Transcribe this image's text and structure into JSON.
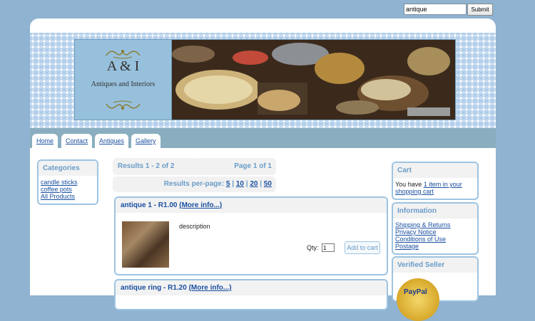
{
  "search": {
    "value": "antique",
    "submit_label": "Submit"
  },
  "logo": {
    "title": "A & I",
    "subtitle": "Antiques and Interiors"
  },
  "nav": {
    "tabs": [
      {
        "label": "Home"
      },
      {
        "label": "Contact"
      },
      {
        "label": "Antiques"
      },
      {
        "label": "Gallery"
      }
    ]
  },
  "categories": {
    "heading": "Categories",
    "items": [
      {
        "label": "candle sticks"
      },
      {
        "label": "coffee pots"
      },
      {
        "label": "All Products"
      }
    ]
  },
  "results": {
    "summary": "Results 1 - 2 of 2",
    "page": "Page 1 of 1",
    "per_page_label": "Results per-page:",
    "per_page_options": [
      "5",
      "10",
      "20",
      "50"
    ],
    "separator": "|"
  },
  "products": [
    {
      "title": "antique 1 - R1.00",
      "more_link": "(More info...)",
      "description": "description",
      "qty_label": "Qty:",
      "qty_value": "1",
      "add_label": "Add to cart"
    },
    {
      "title": "antique ring - R1.20",
      "more_link": "(More info...)"
    }
  ],
  "cart": {
    "heading": "Cart",
    "text_prefix": "You have",
    "link_line1": "1 item in your",
    "link_line2": "shopping cart"
  },
  "information": {
    "heading": "Information",
    "items": [
      {
        "label": "Shipping & Returns"
      },
      {
        "label": "Privacy Notice"
      },
      {
        "label": "Conditions of Use"
      },
      {
        "label": "Postage"
      }
    ]
  },
  "verified": {
    "heading": "Verified Seller",
    "badge_text": "PayPal"
  },
  "colors": {
    "page_bg": "#8fb3d0",
    "accent": "#6a9cc8",
    "link": "#1a4fa0",
    "border": "#9dc4e2"
  }
}
